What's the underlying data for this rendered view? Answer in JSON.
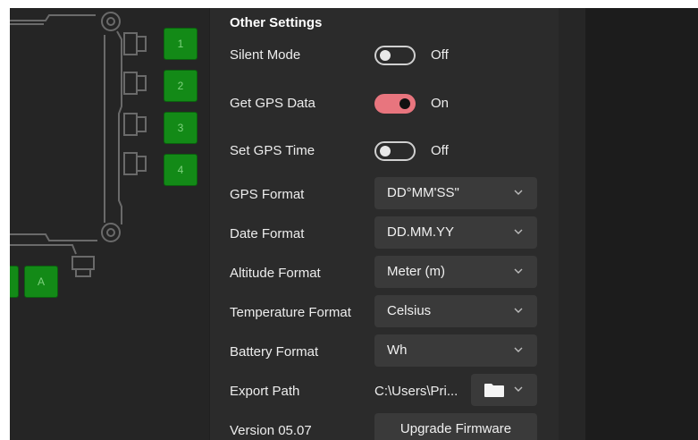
{
  "diagram": {
    "ports": [
      "1",
      "2",
      "3",
      "4"
    ],
    "side_port": "A"
  },
  "settings": {
    "section_title": "Other Settings",
    "toggles": [
      {
        "label": "Silent Mode",
        "state_text": "Off",
        "on": false
      },
      {
        "label": "Get GPS Data",
        "state_text": "On",
        "on": true
      },
      {
        "label": "Set GPS Time",
        "state_text": "Off",
        "on": false
      }
    ],
    "selects": [
      {
        "label": "GPS Format",
        "value": "DD°MM'SS\""
      },
      {
        "label": "Date Format",
        "value": "DD.MM.YY"
      },
      {
        "label": "Altitude Format",
        "value": "Meter (m)"
      },
      {
        "label": "Temperature Format",
        "value": "Celsius"
      },
      {
        "label": "Battery Format",
        "value": "Wh"
      }
    ],
    "export": {
      "label": "Export Path",
      "path": "C:\\Users\\Pri...",
      "icon": "folder-icon"
    },
    "version": {
      "label": "Version 05.07",
      "button": "Upgrade Firmware"
    }
  },
  "colors": {
    "accent": "#e8757e",
    "port_green": "#138a17",
    "panel": "#2b2b2b"
  }
}
